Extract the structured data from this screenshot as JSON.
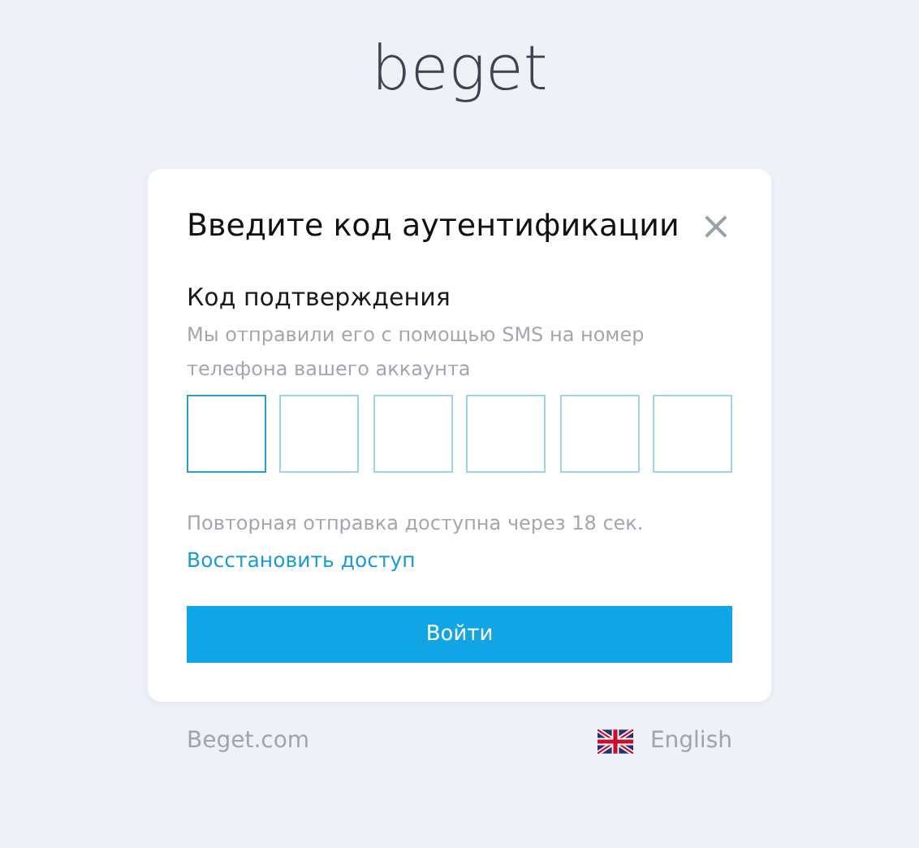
{
  "logo": {
    "text": "beget"
  },
  "dialog": {
    "title": "Введите код аутентификации",
    "close": "×",
    "field_label": "Код подтверждения",
    "hint": "Мы отправили его с помощью SMS на номер телефона вашего аккаунта",
    "code_cells": [
      {
        "focused": true
      },
      {
        "focused": false
      },
      {
        "focused": false
      },
      {
        "focused": false
      },
      {
        "focused": false
      },
      {
        "focused": false
      }
    ],
    "resend_note": "Повторная отправка доступна через 18 сек.",
    "restore_link": "Восстановить доступ",
    "submit_button": "Войти"
  },
  "footer": {
    "site_link": "Beget.com",
    "language": "English"
  }
}
